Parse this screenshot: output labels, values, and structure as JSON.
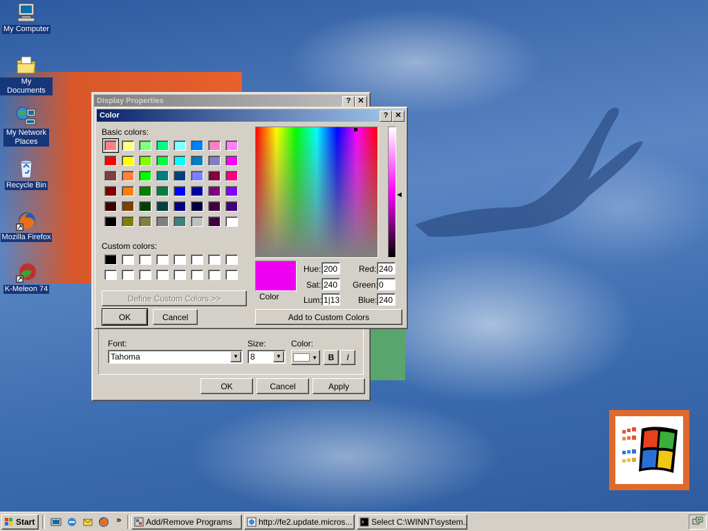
{
  "desktop": {
    "icons": [
      {
        "label": "My Computer",
        "icon": "computer-icon"
      },
      {
        "label": "My Documents",
        "icon": "folder-documents-icon"
      },
      {
        "label": "My Network Places",
        "icon": "network-icon"
      },
      {
        "label": "Recycle Bin",
        "icon": "recycle-bin-icon"
      },
      {
        "label": "Mozilla Firefox",
        "icon": "firefox-icon"
      },
      {
        "label": "K-Meleon 74",
        "icon": "kmeleon-icon"
      }
    ]
  },
  "display_properties": {
    "title": "Display Properties",
    "help_button": "?",
    "close_button": "✕",
    "font_label": "Font:",
    "font_value": "Tahoma",
    "size_label": "Size:",
    "size_value": "8",
    "color_label": "Color:",
    "bold_label": "B",
    "italic_label": "I",
    "ok_label": "OK",
    "cancel_label": "Cancel",
    "apply_label": "Apply"
  },
  "color_dialog": {
    "title": "Color",
    "help_button": "?",
    "close_button": "✕",
    "basic_colors_label": "Basic colors:",
    "custom_colors_label": "Custom colors:",
    "define_custom_label": "Define Custom Colors >>",
    "ok_label": "OK",
    "cancel_label": "Cancel",
    "add_to_custom_label": "Add to Custom Colors",
    "color_solid_label": "Color",
    "hue_label": "Hue:",
    "sat_label": "Sat:",
    "lum_label": "Lum:",
    "red_label": "Red:",
    "green_label": "Green:",
    "blue_label": "Blue:",
    "hue_value": "200",
    "sat_value": "240",
    "lum_value": "1|13",
    "red_value": "240",
    "green_value": "0",
    "blue_value": "240",
    "current_color": "#f000f0",
    "basic_colors": [
      [
        "#ff8080",
        "#ffff80",
        "#80ff80",
        "#00ff80",
        "#80ffff",
        "#0080ff",
        "#ff80c0",
        "#ff80ff"
      ],
      [
        "#ff0000",
        "#ffff00",
        "#80ff00",
        "#00ff40",
        "#00ffff",
        "#0080c0",
        "#8080c0",
        "#ff00ff"
      ],
      [
        "#804040",
        "#ff8040",
        "#00ff00",
        "#008080",
        "#004080",
        "#8080ff",
        "#800040",
        "#ff0080"
      ],
      [
        "#800000",
        "#ff8000",
        "#008000",
        "#008040",
        "#0000ff",
        "#0000a0",
        "#800080",
        "#8000ff"
      ],
      [
        "#400000",
        "#804000",
        "#004000",
        "#004040",
        "#000080",
        "#000040",
        "#400040",
        "#400080"
      ],
      [
        "#000000",
        "#808000",
        "#808040",
        "#808080",
        "#408080",
        "#c0c0c0",
        "#400040",
        "#ffffff"
      ]
    ],
    "custom_colors": [
      [
        "#000000",
        "#ffffff",
        "#ffffff",
        "#ffffff",
        "#ffffff",
        "#ffffff",
        "#ffffff",
        "#ffffff"
      ],
      [
        "#ffffff",
        "#ffffff",
        "#ffffff",
        "#ffffff",
        "#ffffff",
        "#ffffff",
        "#ffffff",
        "#ffffff"
      ]
    ]
  },
  "taskbar": {
    "start_label": "Start",
    "quick_launch_more": "»",
    "tasks": [
      {
        "label": "Add/Remove Programs",
        "icon": "control-panel-icon"
      },
      {
        "label": "http://fe2.update.micros...",
        "icon": "ie-icon"
      },
      {
        "label": "Select C:\\WINNT\\system...",
        "icon": "console-icon"
      }
    ]
  }
}
